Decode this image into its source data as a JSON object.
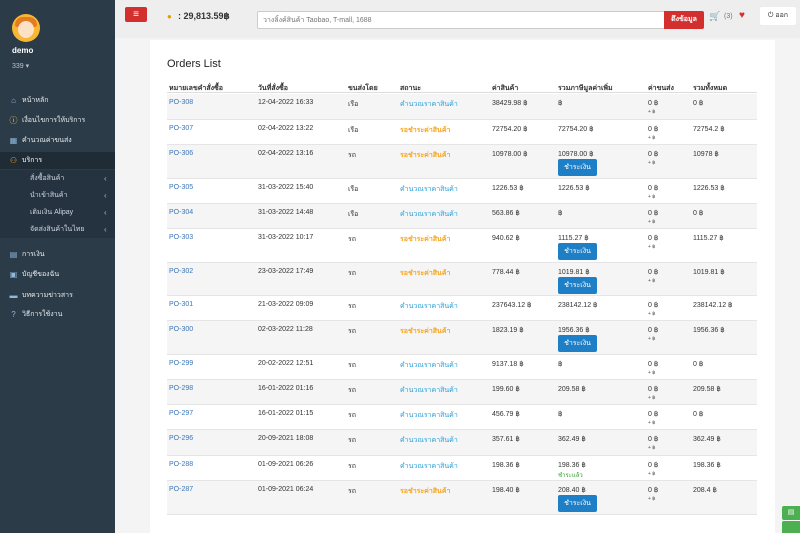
{
  "sidebar": {
    "username": "demo",
    "user_code": "339 ▾",
    "nav": [
      {
        "label": "หน้าหลัก",
        "icon": "home-icon",
        "glyph": "⌂"
      },
      {
        "label": "เงื่อนไขการให้บริการ",
        "icon": "info-icon",
        "glyph": "ⓘ"
      },
      {
        "label": "คำนวณค่าขนส่ง",
        "icon": "calculator-icon",
        "glyph": "▦"
      },
      {
        "label": "บริการ",
        "icon": "service-icon",
        "glyph": "⚇"
      },
      {
        "label": "การเงิน",
        "icon": "money-icon",
        "glyph": "▤"
      },
      {
        "label": "บัญชีของฉัน",
        "icon": "account-icon",
        "glyph": "▣"
      },
      {
        "label": "บทความข่าวสาร",
        "icon": "news-icon",
        "glyph": "▬"
      },
      {
        "label": "วิธีการใช้งาน",
        "icon": "help-icon",
        "glyph": "?"
      }
    ],
    "sub": [
      {
        "label": "สั่งซื้อสินค้า"
      },
      {
        "label": "นำเข้าสินค้า"
      },
      {
        "label": "เติมเงิน Alipay"
      },
      {
        "label": "จัดส่งสินค้าในไทย"
      }
    ]
  },
  "topbar": {
    "balance": ": 29,813.59฿",
    "search_placeholder": "วางลิ้งค์สินค้า Taobao, T-mall, 1688",
    "search_button": "ดึงข้อมูล",
    "cart_count": "(3)",
    "logout": "⏻ ออก"
  },
  "orders": {
    "title": "Orders List",
    "columns": [
      "หมายเลขคำสั่งซื้อ",
      "วันที่สั่งซื้อ",
      "ขนส่งโดย",
      "สถานะ",
      "ค่าสินค้า",
      "รวมภาษีมูลค่าเพิ่ม",
      "ค่าขนส่ง",
      "รวมทั้งหมด"
    ],
    "pay_label": "ชำระเงิน",
    "paid_label": "ชำระแล้ว",
    "sub_shipping": "+ ฿",
    "rows": [
      {
        "po": "PO-308",
        "date": "12-04-2022 16:33",
        "ship": "เรือ",
        "status": "คำนวณราคาสินค้า",
        "status_type": "blue",
        "price": "38429.98 ฿",
        "vat": "฿",
        "shipping": "0 ฿",
        "total": "0 ฿",
        "action": ""
      },
      {
        "po": "PO-307",
        "date": "02-04-2022 13:22",
        "ship": "เรือ",
        "status": "รอชำระค่าสินค้า",
        "status_type": "orange",
        "price": "72754.20 ฿",
        "vat": "72754.20 ฿",
        "shipping": "0 ฿",
        "total": "72754.2 ฿",
        "action": ""
      },
      {
        "po": "PO-306",
        "date": "02-04-2022 13:16",
        "ship": "รถ",
        "status": "รอชำระค่าสินค้า",
        "status_type": "orange",
        "price": "10978.00 ฿",
        "vat": "10978.00 ฿",
        "shipping": "0 ฿",
        "total": "10978 ฿",
        "action": "pay"
      },
      {
        "po": "PO-305",
        "date": "31-03-2022 15:40",
        "ship": "เรือ",
        "status": "คำนวณราคาสินค้า",
        "status_type": "blue",
        "price": "1226.53 ฿",
        "vat": "1226.53 ฿",
        "shipping": "0 ฿",
        "total": "1226.53 ฿",
        "action": ""
      },
      {
        "po": "PO-304",
        "date": "31-03-2022 14:48",
        "ship": "เรือ",
        "status": "คำนวณราคาสินค้า",
        "status_type": "blue",
        "price": "563.86 ฿",
        "vat": "฿",
        "shipping": "0 ฿",
        "total": "0 ฿",
        "action": ""
      },
      {
        "po": "PO-303",
        "date": "31-03-2022 10:17",
        "ship": "รถ",
        "status": "รอชำระค่าสินค้า",
        "status_type": "orange",
        "price": "940.62 ฿",
        "vat": "1115.27 ฿",
        "shipping": "0 ฿",
        "total": "1115.27 ฿",
        "action": "pay"
      },
      {
        "po": "PO-302",
        "date": "23-03-2022 17:49",
        "ship": "รถ",
        "status": "รอชำระค่าสินค้า",
        "status_type": "orange",
        "price": "778.44 ฿",
        "vat": "1019.81 ฿",
        "shipping": "0 ฿",
        "total": "1019.81 ฿",
        "action": "pay"
      },
      {
        "po": "PO-301",
        "date": "21-03-2022 09:09",
        "ship": "รถ",
        "status": "คำนวณราคาสินค้า",
        "status_type": "blue",
        "price": "237643.12 ฿",
        "vat": "238142.12 ฿",
        "shipping": "0 ฿",
        "total": "238142.12 ฿",
        "action": ""
      },
      {
        "po": "PO-300",
        "date": "02-03-2022 11:28",
        "ship": "รถ",
        "status": "รอชำระค่าสินค้า",
        "status_type": "orange",
        "price": "1823.19 ฿",
        "vat": "1956.36 ฿",
        "shipping": "0 ฿",
        "total": "1956.36 ฿",
        "action": "pay"
      },
      {
        "po": "PO-299",
        "date": "20-02-2022 12:51",
        "ship": "รถ",
        "status": "คำนวณราคาสินค้า",
        "status_type": "blue",
        "price": "9137.18 ฿",
        "vat": "฿",
        "shipping": "0 ฿",
        "total": "0 ฿",
        "action": ""
      },
      {
        "po": "PO-298",
        "date": "16-01-2022 01:16",
        "ship": "รถ",
        "status": "คำนวณราคาสินค้า",
        "status_type": "blue",
        "price": "199.60 ฿",
        "vat": "209.58 ฿",
        "shipping": "0 ฿",
        "total": "209.58 ฿",
        "action": ""
      },
      {
        "po": "PO-297",
        "date": "16-01-2022 01:15",
        "ship": "รถ",
        "status": "คำนวณราคาสินค้า",
        "status_type": "blue",
        "price": "456.79 ฿",
        "vat": "฿",
        "shipping": "0 ฿",
        "total": "0 ฿",
        "action": ""
      },
      {
        "po": "PO-296",
        "date": "20-09-2021 18:08",
        "ship": "รถ",
        "status": "คำนวณราคาสินค้า",
        "status_type": "blue",
        "price": "357.61 ฿",
        "vat": "362.49 ฿",
        "shipping": "0 ฿",
        "total": "362.49 ฿",
        "action": ""
      },
      {
        "po": "PO-288",
        "date": "01-09-2021 06:26",
        "ship": "รถ",
        "status": "คำนวณราคาสินค้า",
        "status_type": "blue",
        "price": "198.36 ฿",
        "vat": "198.36 ฿",
        "shipping": "0 ฿",
        "total": "198.36 ฿",
        "action": "paid"
      },
      {
        "po": "PO-287",
        "date": "01-09-2021 06:24",
        "ship": "รถ",
        "status": "รอชำระค่าสินค้า",
        "status_type": "orange",
        "price": "198.40 ฿",
        "vat": "208.40 ฿",
        "shipping": "0 ฿",
        "total": "208.4 ฿",
        "action": "pay"
      }
    ]
  },
  "colors": {
    "sidebar": "#2c3b48",
    "accent_red": "#d32f2f",
    "link_blue": "#3a76b8",
    "pay_blue": "#1f7fc6",
    "status_orange": "#f5a623"
  }
}
